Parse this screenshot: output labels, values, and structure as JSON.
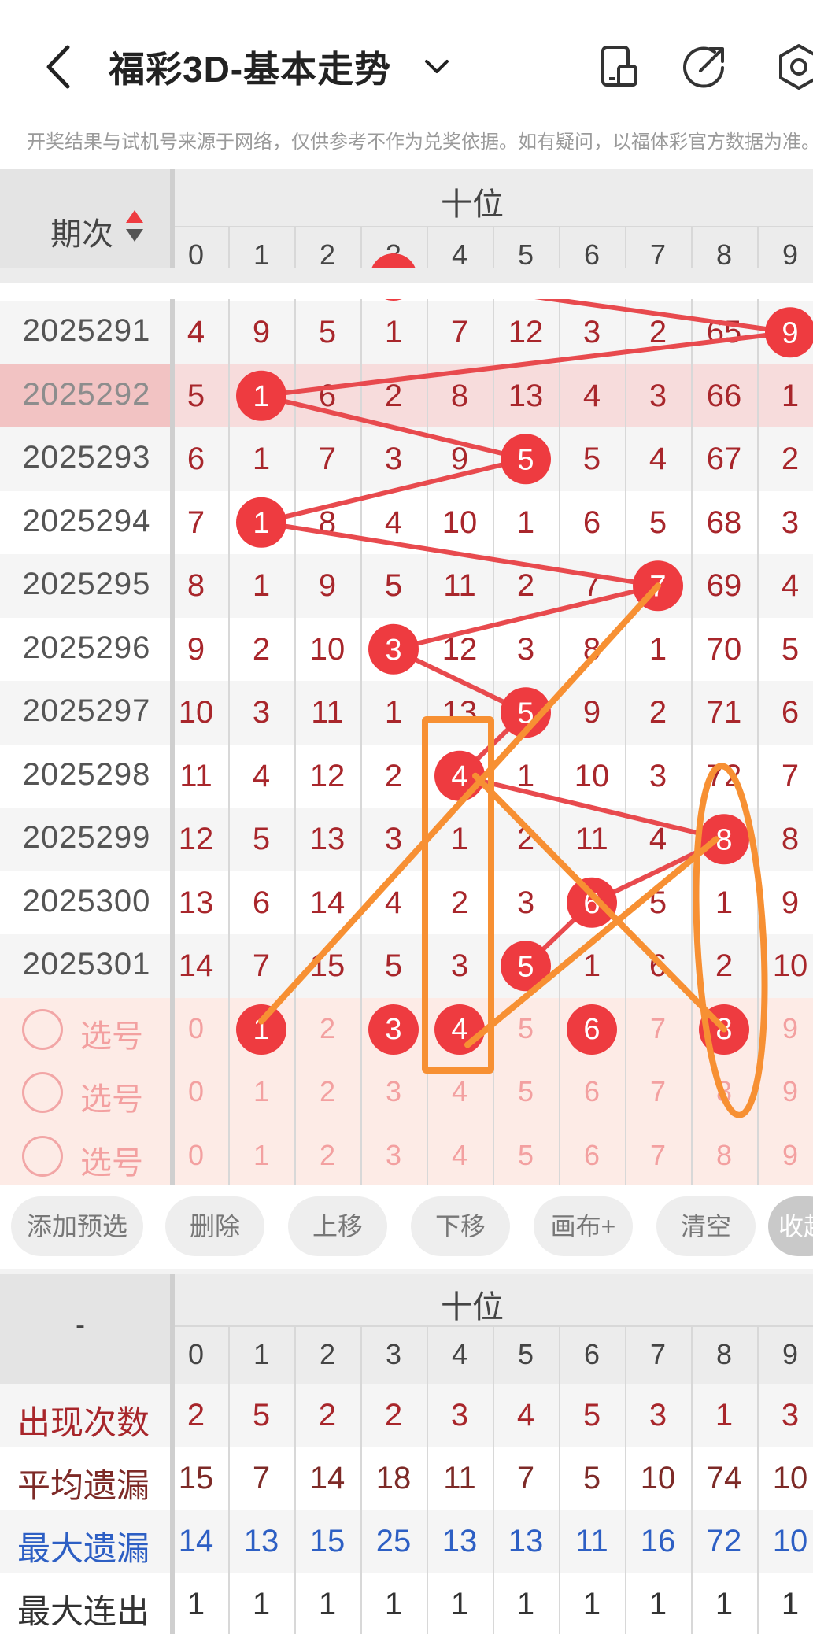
{
  "header": {
    "title": "福彩3D-基本走势",
    "icons": [
      "back-arrow-icon",
      "dropdown-chevron-icon",
      "phone-layout-icon",
      "share-icon",
      "settings-gear-icon"
    ]
  },
  "notice": "开奖结果与试机号来源于网络，仅供参考不作为兑奖依据。如有疑问，以福体彩官方数据为准。",
  "main_table": {
    "period_header": "期次",
    "section_header": "十位",
    "digits": [
      "0",
      "1",
      "2",
      "3",
      "4",
      "5",
      "6",
      "7",
      "8",
      "9"
    ],
    "rows": [
      {
        "period": "2025291",
        "cells": [
          "4",
          "9",
          "5",
          "1",
          "7",
          "12",
          "3",
          "2",
          "65",
          "9"
        ],
        "hit": 9,
        "highlight": false
      },
      {
        "period": "2025292",
        "cells": [
          "5",
          "1",
          "6",
          "2",
          "8",
          "13",
          "4",
          "3",
          "66",
          "1"
        ],
        "hit": 1,
        "highlight": true
      },
      {
        "period": "2025293",
        "cells": [
          "6",
          "1",
          "7",
          "3",
          "9",
          "5",
          "5",
          "4",
          "67",
          "2"
        ],
        "hit": 5,
        "highlight": false
      },
      {
        "period": "2025294",
        "cells": [
          "7",
          "1",
          "8",
          "4",
          "10",
          "1",
          "6",
          "5",
          "68",
          "3"
        ],
        "hit": 1,
        "highlight": false
      },
      {
        "period": "2025295",
        "cells": [
          "8",
          "1",
          "9",
          "5",
          "11",
          "2",
          "7",
          "7",
          "69",
          "4"
        ],
        "hit": 7,
        "highlight": false
      },
      {
        "period": "2025296",
        "cells": [
          "9",
          "2",
          "10",
          "3",
          "12",
          "3",
          "8",
          "1",
          "70",
          "5"
        ],
        "hit": 3,
        "highlight": false
      },
      {
        "period": "2025297",
        "cells": [
          "10",
          "3",
          "11",
          "1",
          "13",
          "5",
          "9",
          "2",
          "71",
          "6"
        ],
        "hit": 5,
        "highlight": false
      },
      {
        "period": "2025298",
        "cells": [
          "11",
          "4",
          "12",
          "2",
          "4",
          "1",
          "10",
          "3",
          "72",
          "7"
        ],
        "hit": 4,
        "highlight": false
      },
      {
        "period": "2025299",
        "cells": [
          "12",
          "5",
          "13",
          "3",
          "1",
          "2",
          "11",
          "4",
          "8",
          "8"
        ],
        "hit": 8,
        "highlight": false
      },
      {
        "period": "2025300",
        "cells": [
          "13",
          "6",
          "14",
          "4",
          "2",
          "3",
          "6",
          "5",
          "1",
          "9"
        ],
        "hit": 6,
        "highlight": false
      },
      {
        "period": "2025301",
        "cells": [
          "14",
          "7",
          "15",
          "5",
          "3",
          "5",
          "1",
          "6",
          "2",
          "10"
        ],
        "hit": 5,
        "highlight": false
      }
    ],
    "pick_label": "选号",
    "pick_rows": [
      {
        "cells": [
          "0",
          "1",
          "3",
          "4",
          "6",
          "8"
        ],
        "selected": [
          1,
          3,
          4,
          6,
          8
        ]
      },
      {
        "cells": [
          "0",
          "1",
          "2",
          "3",
          "4",
          "5",
          "6",
          "7",
          "8",
          "9"
        ],
        "selected": []
      },
      {
        "cells": [
          "0",
          "1",
          "2",
          "3",
          "4",
          "5",
          "6",
          "7",
          "8",
          "9"
        ],
        "selected": []
      }
    ]
  },
  "buttons": [
    "添加预选",
    "删除",
    "上移",
    "下移",
    "画布+",
    "清空",
    "收起"
  ],
  "stats_table": {
    "corner": "-",
    "section_header": "十位",
    "digits": [
      "0",
      "1",
      "2",
      "3",
      "4",
      "5",
      "6",
      "7",
      "8",
      "9"
    ],
    "rows": [
      {
        "label": "出现次数",
        "values": [
          "2",
          "5",
          "2",
          "2",
          "3",
          "4",
          "5",
          "3",
          "1",
          "3"
        ],
        "color": "#a8262b"
      },
      {
        "label": "平均遗漏",
        "values": [
          "15",
          "7",
          "14",
          "18",
          "11",
          "7",
          "5",
          "10",
          "74",
          "10"
        ],
        "color": "#7d2a27"
      },
      {
        "label": "最大遗漏",
        "values": [
          "14",
          "13",
          "15",
          "25",
          "13",
          "13",
          "11",
          "16",
          "72",
          "10"
        ],
        "color": "#2d5fc4"
      },
      {
        "label": "最大连出",
        "values": [
          "1",
          "1",
          "1",
          "1",
          "1",
          "1",
          "1",
          "1",
          "1",
          "1"
        ],
        "color": "#333333"
      }
    ]
  },
  "colors": {
    "hit_ball": "#ee3b40",
    "trend_line": "#e84a4e",
    "annotation": "#f79033",
    "miss_text": "#a8262b",
    "pick_text": "#f3a0a0",
    "highlight_row": "#f7dcdc",
    "pick_bg": "#fdebe6"
  }
}
